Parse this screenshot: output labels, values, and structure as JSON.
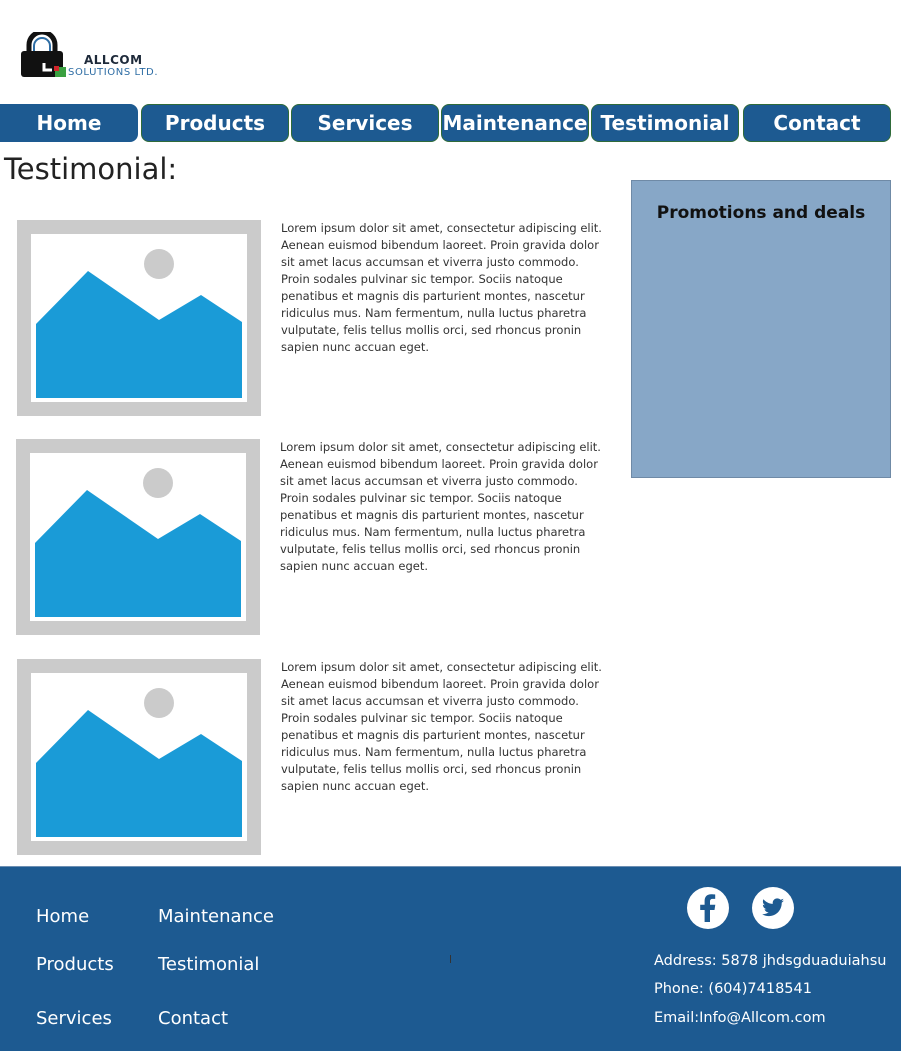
{
  "logo": {
    "line1": "ALLCOM",
    "line2": "SOLUTIONS LTD.",
    "colors": {
      "lock": "#111111",
      "accent_blue": "#2e6da4",
      "accent_green": "#3aa040",
      "accent_red": "#d0262b"
    }
  },
  "nav": {
    "items": [
      "Home",
      "Products",
      "Services",
      "Maintenance",
      "Testimonial",
      "Contact"
    ],
    "color": "#1d5a91"
  },
  "page": {
    "title": "Testimonial:"
  },
  "testimonials": [
    {
      "image_icon": "image-placeholder-icon",
      "text": "Lorem ipsum dolor sit amet, consectetur adipiscing elit. Aenean euismod bibendum laoreet. Proin gravida dolor sit amet lacus accumsan et viverra justo commodo. Proin sodales pulvinar sic tempor. Sociis natoque penatibus et magnis dis parturient montes, nascetur ridiculus mus. Nam fermentum, nulla luctus pharetra vulputate, felis tellus mollis orci, sed rhoncus pronin sapien nunc accuan eget."
    },
    {
      "image_icon": "image-placeholder-icon",
      "text": "Lorem ipsum dolor sit amet, consectetur adipiscing elit. Aenean euismod bibendum laoreet. Proin gravida dolor sit amet lacus accumsan et viverra justo commodo. Proin sodales pulvinar sic tempor. Sociis natoque penatibus et magnis dis parturient montes, nascetur ridiculus mus. Nam fermentum, nulla luctus pharetra vulputate, felis tellus mollis orci, sed rhoncus pronin sapien nunc accuan eget."
    },
    {
      "image_icon": "image-placeholder-icon",
      "text": "Lorem ipsum dolor sit amet, consectetur adipiscing elit. Aenean euismod bibendum laoreet. Proin gravida dolor sit amet lacus accumsan et viverra justo commodo. Proin sodales pulvinar sic tempor. Sociis natoque penatibus et magnis dis parturient montes, nascetur ridiculus mus. Nam fermentum, nulla luctus pharetra vulputate, felis tellus mollis orci, sed rhoncus pronin sapien nunc accuan eget."
    }
  ],
  "promo": {
    "title": "Promotions and deals",
    "background": "#87a7c7"
  },
  "footer": {
    "links": [
      "Home",
      "Maintenance",
      "Products",
      "Testimonial",
      "Services",
      "Contact"
    ],
    "address": "Address: 5878 jhdsgduaduiahsu",
    "phone": "Phone: (604)7418541",
    "email": "Email:Info@Allcom.com",
    "social": [
      "facebook-icon",
      "twitter-icon"
    ],
    "background": "#1d5a91"
  }
}
